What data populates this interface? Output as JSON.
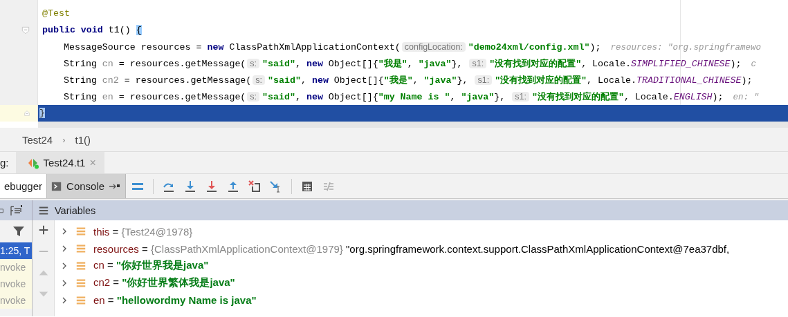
{
  "editor": {
    "lines": [
      {
        "kind": "member",
        "current": false,
        "tokens": [
          {
            "kind": "annotation",
            "text": "@Test"
          }
        ]
      },
      {
        "kind": "member",
        "current": false,
        "tokens": [
          {
            "kind": "keyword",
            "text": "public void"
          },
          {
            "kind": "plain",
            "text": " t1() "
          },
          {
            "kind": "match",
            "text": "{"
          }
        ]
      },
      {
        "kind": "statement",
        "current": false,
        "tokens": [
          {
            "kind": "plain",
            "text": "MessageSource resources = "
          },
          {
            "kind": "keyword",
            "text": "new"
          },
          {
            "kind": "plain",
            "text": " ClassPathXmlApplicationContext("
          },
          {
            "kind": "hint",
            "text": "configLocation:"
          },
          {
            "kind": "string",
            "text": "\"demo24xml/config.xml\""
          },
          {
            "kind": "plain",
            "text": ");"
          },
          {
            "kind": "inlay",
            "text": "resources: \"org.springframewo"
          }
        ]
      },
      {
        "kind": "statement",
        "current": false,
        "tokens": [
          {
            "kind": "plain",
            "text": "String "
          },
          {
            "kind": "local",
            "text": "cn"
          },
          {
            "kind": "plain",
            "text": " = resources.getMessage("
          },
          {
            "kind": "hint",
            "text": "s:"
          },
          {
            "kind": "string",
            "text": "\"said\""
          },
          {
            "kind": "plain",
            "text": ", "
          },
          {
            "kind": "keyword",
            "text": "new"
          },
          {
            "kind": "plain",
            "text": " Object[]{"
          },
          {
            "kind": "string",
            "text": "\"我是\""
          },
          {
            "kind": "plain",
            "text": ", "
          },
          {
            "kind": "string",
            "text": "\"java\""
          },
          {
            "kind": "plain",
            "text": "}, "
          },
          {
            "kind": "hint",
            "text": "s1:"
          },
          {
            "kind": "string",
            "text": "\"没有找到对应的配置\""
          },
          {
            "kind": "plain",
            "text": ", Locale."
          },
          {
            "kind": "constant",
            "text": "SIMPLIFIED_CHINESE"
          },
          {
            "kind": "plain",
            "text": ");"
          },
          {
            "kind": "inlay",
            "text": "c"
          }
        ]
      },
      {
        "kind": "statement",
        "current": false,
        "tokens": [
          {
            "kind": "plain",
            "text": "String "
          },
          {
            "kind": "local",
            "text": "cn2"
          },
          {
            "kind": "plain",
            "text": " = resources.getMessage("
          },
          {
            "kind": "hint",
            "text": "s:"
          },
          {
            "kind": "string",
            "text": "\"said\""
          },
          {
            "kind": "plain",
            "text": ", "
          },
          {
            "kind": "keyword",
            "text": "new"
          },
          {
            "kind": "plain",
            "text": " Object[]{"
          },
          {
            "kind": "string",
            "text": "\"我是\""
          },
          {
            "kind": "plain",
            "text": ", "
          },
          {
            "kind": "string",
            "text": "\"java\""
          },
          {
            "kind": "plain",
            "text": "}, "
          },
          {
            "kind": "hint",
            "text": "s1:"
          },
          {
            "kind": "string",
            "text": "\"没有找到对应的配置\""
          },
          {
            "kind": "plain",
            "text": ", Locale."
          },
          {
            "kind": "constant",
            "text": "TRADITIONAL_CHINESE"
          },
          {
            "kind": "plain",
            "text": ");"
          }
        ]
      },
      {
        "kind": "statement",
        "current": false,
        "tokens": [
          {
            "kind": "plain",
            "text": "String "
          },
          {
            "kind": "local",
            "text": "en"
          },
          {
            "kind": "plain",
            "text": " = resources.getMessage("
          },
          {
            "kind": "hint",
            "text": "s:"
          },
          {
            "kind": "string",
            "text": "\"said\""
          },
          {
            "kind": "plain",
            "text": ", "
          },
          {
            "kind": "keyword",
            "text": "new"
          },
          {
            "kind": "plain",
            "text": " Object[]{"
          },
          {
            "kind": "string",
            "text": "\"my Name is \""
          },
          {
            "kind": "plain",
            "text": ", "
          },
          {
            "kind": "string",
            "text": "\"java\""
          },
          {
            "kind": "plain",
            "text": "}, "
          },
          {
            "kind": "hint",
            "text": "s1:"
          },
          {
            "kind": "string",
            "text": "\"没有找到对应的配置\""
          },
          {
            "kind": "plain",
            "text": ", Locale."
          },
          {
            "kind": "constant",
            "text": "ENGLISH"
          },
          {
            "kind": "plain",
            "text": ");"
          },
          {
            "kind": "inlay",
            "text": "en: \""
          }
        ]
      },
      {
        "kind": "member",
        "current": true,
        "tokens": [
          {
            "kind": "match",
            "text": "}"
          }
        ]
      }
    ]
  },
  "breadcrumbs": [
    "Test24",
    "t1()"
  ],
  "breadcrumb_separator": "›",
  "debug_bar": {
    "label": "g:",
    "tabs": [
      {
        "label": "Test24.t1",
        "selected": true,
        "close": "×"
      }
    ]
  },
  "panel_tabs": [
    {
      "label": "ebugger",
      "selected": true
    },
    {
      "label": "Console",
      "selected": false
    }
  ],
  "variables_title": "Variables",
  "frames": [
    {
      "label": "1:25, T",
      "selected": true
    },
    {
      "label": "nvoke",
      "selected": false
    },
    {
      "label": "nvoke",
      "selected": false
    },
    {
      "label": "nvoke",
      "selected": false
    }
  ],
  "variables": [
    {
      "name": "this",
      "operator": "=",
      "expanded": false,
      "value": [
        {
          "kind": "object",
          "text": "{Test24@1978}"
        }
      ]
    },
    {
      "name": "resources",
      "operator": "=",
      "expanded": false,
      "value": [
        {
          "kind": "object",
          "text": "{ClassPathXmlApplicationContext@1979}"
        },
        {
          "kind": "text",
          "text": "\"org.springframework.context.support.ClassPathXmlApplicationContext@7ea37dbf,"
        }
      ]
    },
    {
      "name": "cn",
      "operator": "=",
      "expanded": false,
      "value": [
        {
          "kind": "string",
          "text": "\"你好世界我是java\""
        }
      ]
    },
    {
      "name": "cn2",
      "operator": "=",
      "expanded": false,
      "value": [
        {
          "kind": "string",
          "text": "\"你好世界繁体我是java\""
        }
      ]
    },
    {
      "name": "en",
      "operator": "=",
      "expanded": false,
      "value": [
        {
          "kind": "string",
          "text": "\"hellowordmy Name is java\""
        }
      ]
    }
  ]
}
